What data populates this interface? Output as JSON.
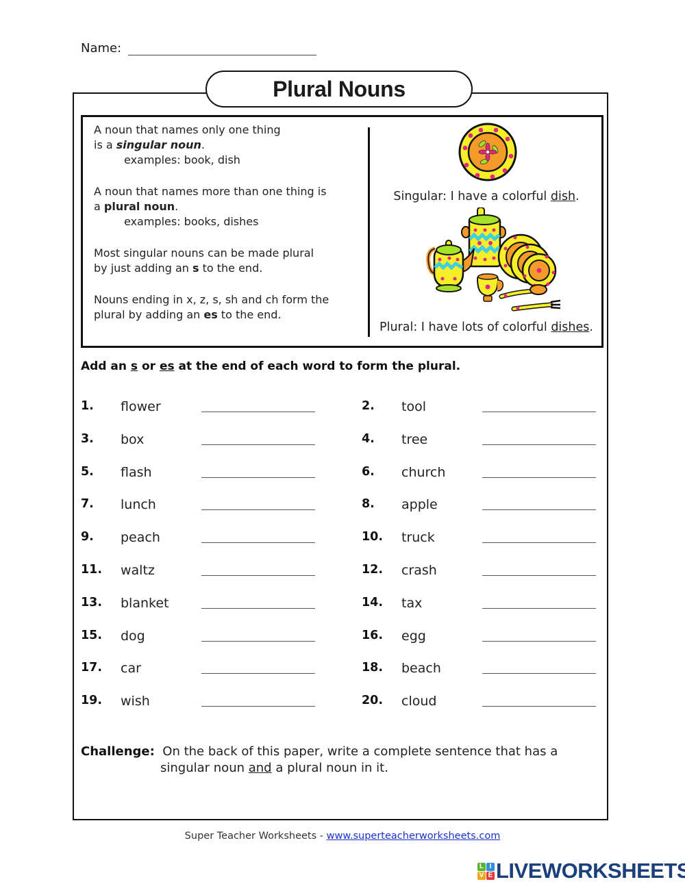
{
  "header": {
    "name_label": "Name:",
    "title": "Plural Nouns"
  },
  "info": {
    "singular_line1": "A noun that names only one thing",
    "singular_line2_pre": "is a ",
    "singular_term": "singular noun",
    "singular_line2_post": ".",
    "singular_examples": "examples:  book, dish",
    "plural_line1": "A noun that names more than one  thing is",
    "plural_line2_pre": "a ",
    "plural_term": "plural noun",
    "plural_line2_post": ".",
    "plural_examples": "examples:  books, dishes",
    "rule_s_line1": "Most singular nouns can be made plural",
    "rule_s_line2_pre": "by just adding an ",
    "rule_s_suffix": "s",
    "rule_s_line2_post": " to the end.",
    "rule_es_line1": "Nouns ending in x, z, s, sh and ch form the",
    "rule_es_line2_pre": "plural by adding an ",
    "rule_es_suffix": "es",
    "rule_es_line2_post": " to the end."
  },
  "illustration": {
    "singular_pre": "Singular:  I have a colorful ",
    "singular_word": "dish",
    "singular_post": ".",
    "plural_pre": "Plural: I have lots of colorful ",
    "plural_word": "dishes",
    "plural_post": ".",
    "colors": {
      "yellow": "#f7ee2a",
      "orange": "#f39a2b",
      "pink": "#e4277e",
      "green": "#a6e22a",
      "cyan": "#3fd0e0"
    }
  },
  "instructions": {
    "pre": "Add an ",
    "s": "s",
    "mid": " or ",
    "es": "es",
    "post": " at the end of each word to form the plural."
  },
  "words": [
    {
      "num": "1.",
      "word": "flower"
    },
    {
      "num": "2.",
      "word": "tool"
    },
    {
      "num": "3.",
      "word": "box"
    },
    {
      "num": "4.",
      "word": "tree"
    },
    {
      "num": "5.",
      "word": "flash"
    },
    {
      "num": "6.",
      "word": "church"
    },
    {
      "num": "7.",
      "word": "lunch"
    },
    {
      "num": "8.",
      "word": "apple"
    },
    {
      "num": "9.",
      "word": "peach"
    },
    {
      "num": "10.",
      "word": "truck"
    },
    {
      "num": "11.",
      "word": "waltz"
    },
    {
      "num": "12.",
      "word": "crash"
    },
    {
      "num": "13.",
      "word": "blanket"
    },
    {
      "num": "14.",
      "word": "tax"
    },
    {
      "num": "15.",
      "word": "dog"
    },
    {
      "num": "16.",
      "word": "egg"
    },
    {
      "num": "17.",
      "word": "car"
    },
    {
      "num": "18.",
      "word": "beach"
    },
    {
      "num": "19.",
      "word": "wish"
    },
    {
      "num": "20.",
      "word": "cloud"
    }
  ],
  "challenge": {
    "label": "Challenge:",
    "line1": "On the back of this paper, write a complete sentence that has a",
    "line2_pre": "singular noun ",
    "line2_and": "and",
    "line2_post": " a plural noun in it."
  },
  "footer": {
    "source": "Super Teacher Worksheets  -  ",
    "link": "www.superteacherworksheets.com",
    "link_color": "#1a33cc"
  },
  "brand": {
    "tiles": [
      {
        "letter": "L",
        "color": "#5cb531"
      },
      {
        "letter": "I",
        "color": "#2f8fd8"
      },
      {
        "letter": "V",
        "color": "#f2a81d"
      },
      {
        "letter": "E",
        "color": "#e2393a"
      }
    ],
    "wordmark": "LIVEWORKSHEETS",
    "wordmark_color": "#1b3f7a"
  }
}
